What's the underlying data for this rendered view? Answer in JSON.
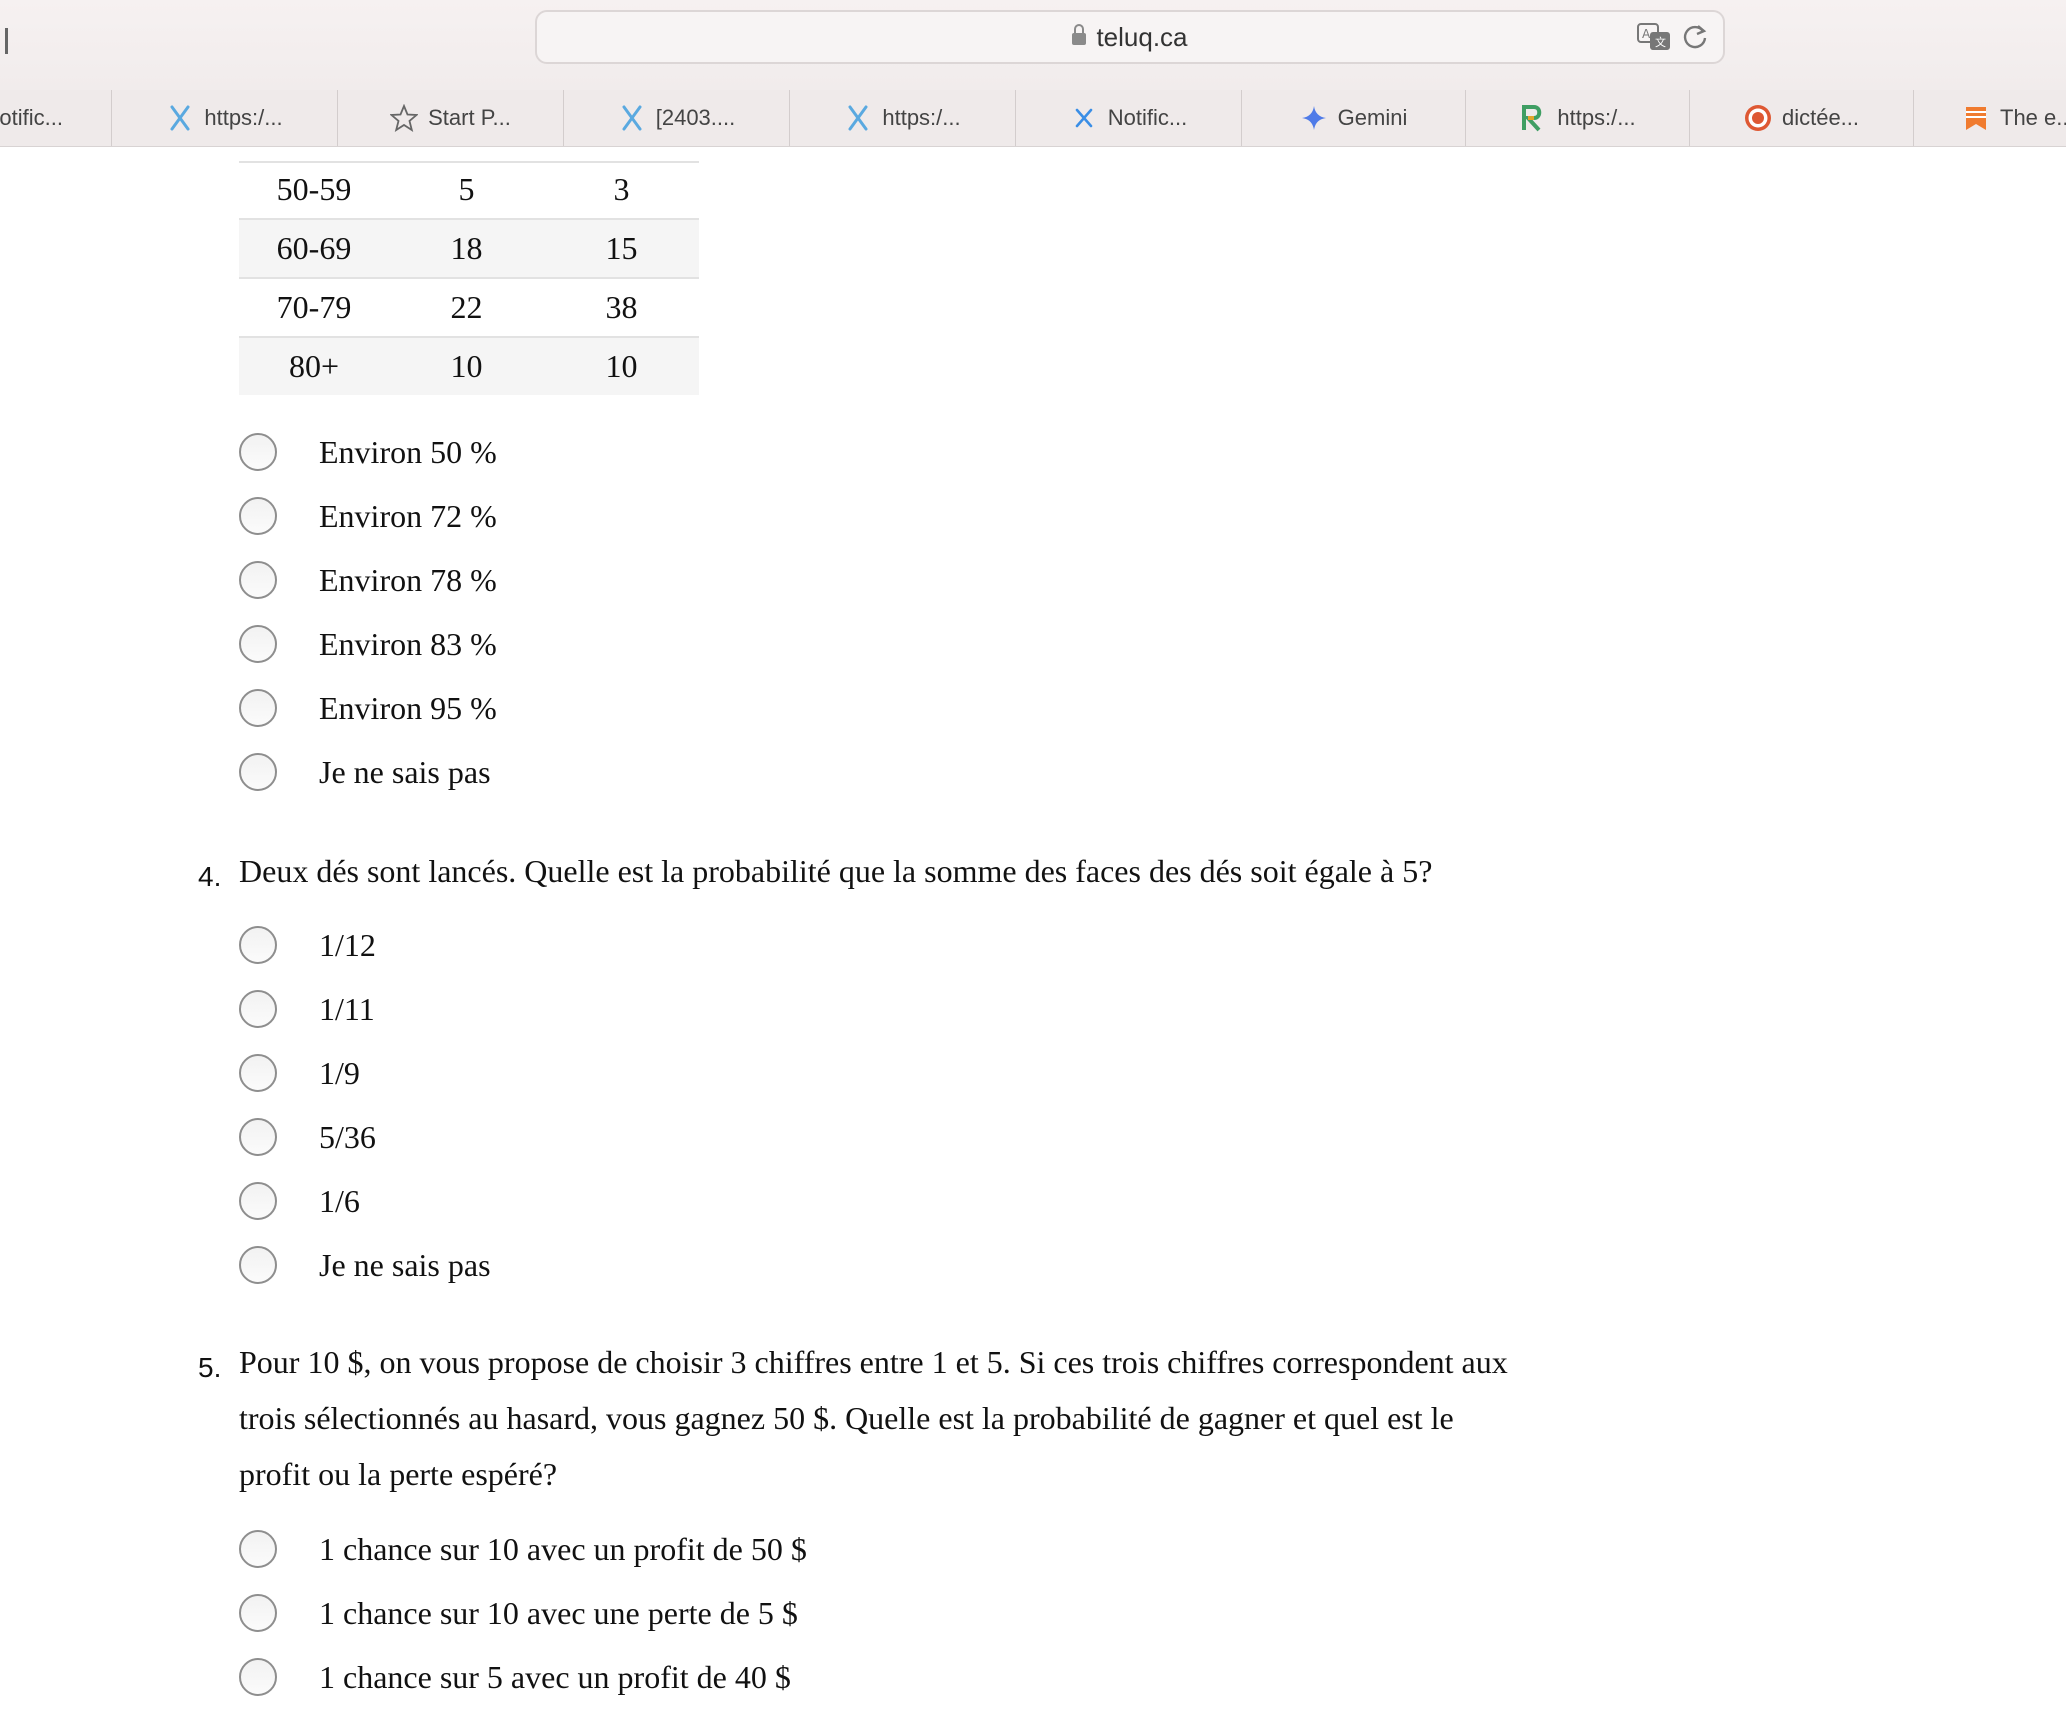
{
  "browser": {
    "url": "teluq.ca",
    "tabs": [
      {
        "label": "otific...",
        "icon": "none"
      },
      {
        "label": "https:/...",
        "icon": "grok-icon"
      },
      {
        "label": "Start P...",
        "icon": "star-icon"
      },
      {
        "label": "[2403....",
        "icon": "grok-icon"
      },
      {
        "label": "https:/...",
        "icon": "grok-icon"
      },
      {
        "label": "Notific...",
        "icon": "x-icon"
      },
      {
        "label": "Gemini",
        "icon": "gemini-icon"
      },
      {
        "label": "https:/...",
        "icon": "r-icon"
      },
      {
        "label": "dictée...",
        "icon": "duckduckgo-icon"
      },
      {
        "label": "The e...",
        "icon": "bookmark-icon"
      }
    ]
  },
  "table": {
    "rows": [
      [
        "50-59",
        "5",
        "3"
      ],
      [
        "60-69",
        "18",
        "15"
      ],
      [
        "70-79",
        "22",
        "38"
      ],
      [
        "80+",
        "10",
        "10"
      ]
    ]
  },
  "q3": {
    "options": [
      "Environ 50 %",
      "Environ 72 %",
      "Environ 78 %",
      "Environ 83 %",
      "Environ 95 %",
      "Je ne sais pas"
    ]
  },
  "q4": {
    "number": "4.",
    "text": "Deux dés sont lancés. Quelle est la probabilité que la somme des faces des dés soit égale à 5?",
    "options": [
      "1/12",
      "1/11",
      "1/9",
      "5/36",
      "1/6",
      "Je ne sais pas"
    ]
  },
  "q5": {
    "number": "5.",
    "lines": [
      "Pour 10 $, on vous propose de choisir 3 chiffres entre 1 et 5. Si ces trois chiffres correspondent aux",
      "trois sélectionnés au hasard, vous gagnez 50 $. Quelle est la probabilité de gagner et quel est le",
      "profit ou la perte espéré?"
    ],
    "options": [
      "1 chance sur 10 avec un profit de 50 $",
      "1 chance sur 10 avec une perte de 5 $",
      "1 chance sur 5 avec un profit de 40 $"
    ]
  }
}
